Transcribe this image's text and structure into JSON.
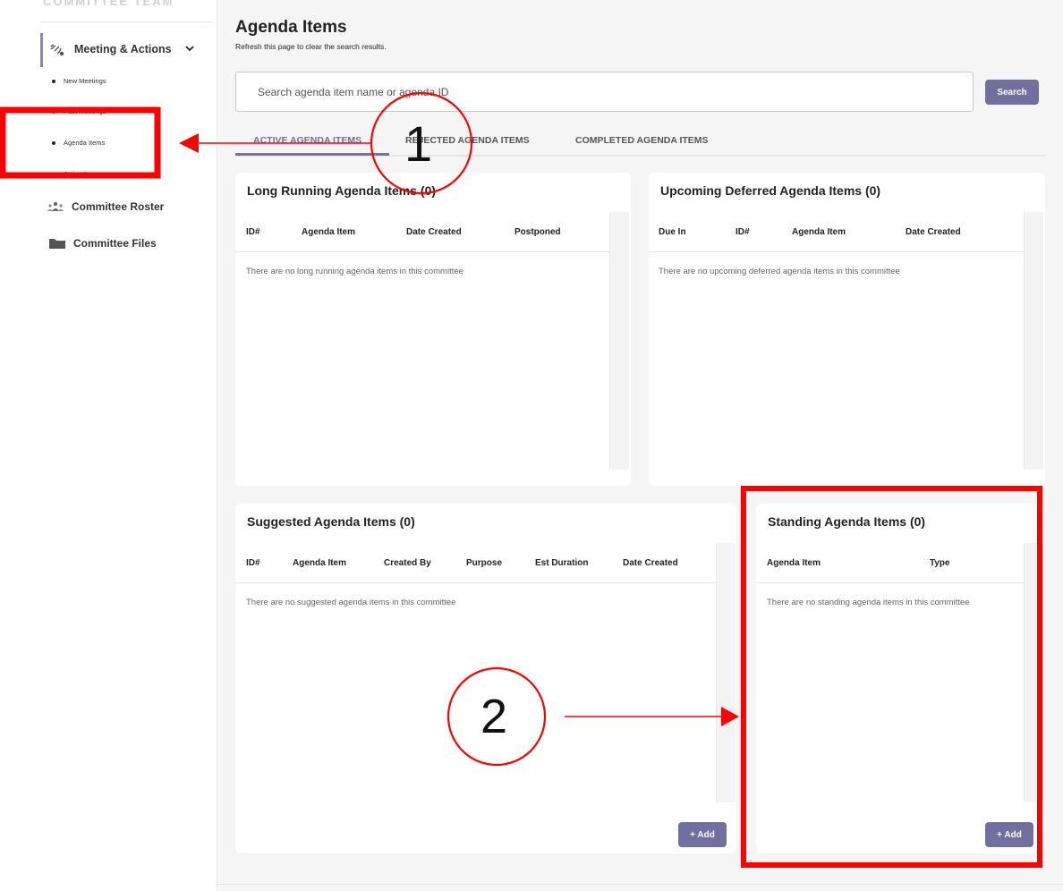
{
  "sidebar": {
    "cut_title": "COMMITTEE TEAM",
    "section": {
      "label": "Meeting & Actions",
      "icon": "meeting-icon",
      "expanded": true
    },
    "sub_items": [
      {
        "label": "New Meetings"
      },
      {
        "label": "Past Meetings"
      },
      {
        "label": "Agenda Items"
      },
      {
        "label": "Action Items"
      }
    ],
    "items": [
      {
        "label": "Committee Roster",
        "icon": "people-icon"
      },
      {
        "label": "Committee Files",
        "icon": "folder-icon"
      }
    ]
  },
  "header": {
    "title": "Agenda Items",
    "subtitle": "Refresh this page to clear the search results."
  },
  "search": {
    "placeholder": "Search agenda item name or agenda ID",
    "value": "",
    "button_label": "Search"
  },
  "tabs": [
    {
      "label": "ACTIVE AGENDA ITEMS",
      "active": true
    },
    {
      "label": "REJECTED AGENDA ITEMS",
      "active": false
    },
    {
      "label": "COMPLETED AGENDA ITEMS",
      "active": false
    }
  ],
  "panels": {
    "long_running": {
      "title": "Long Running Agenda Items (0)",
      "columns": [
        "ID#",
        "Agenda Item",
        "Date Created",
        "Postponed"
      ],
      "empty": "There are no long running agenda items in this committee"
    },
    "upcoming_deferred": {
      "title": "Upcoming Deferred Agenda Items (0)",
      "columns": [
        "Due In",
        "ID#",
        "Agenda Item",
        "Date Created"
      ],
      "empty": "There are no upcoming deferred agenda items in this committee"
    },
    "suggested": {
      "title": "Suggested Agenda Items (0)",
      "columns": [
        "ID#",
        "Agenda Item",
        "Created By",
        "Purpose",
        "Est Duration",
        "Date Created"
      ],
      "empty": "There are no suggested agenda items in this committee",
      "add_label": "+ Add"
    },
    "standing": {
      "title": "Standing Agenda Items (0)",
      "columns": [
        "Agenda Item",
        "Type"
      ],
      "empty": "There are no standing agenda items in this committee",
      "add_label": "+ Add"
    }
  },
  "annotations": {
    "marker_1": "1",
    "marker_2": "2",
    "color": "#ff0000"
  }
}
